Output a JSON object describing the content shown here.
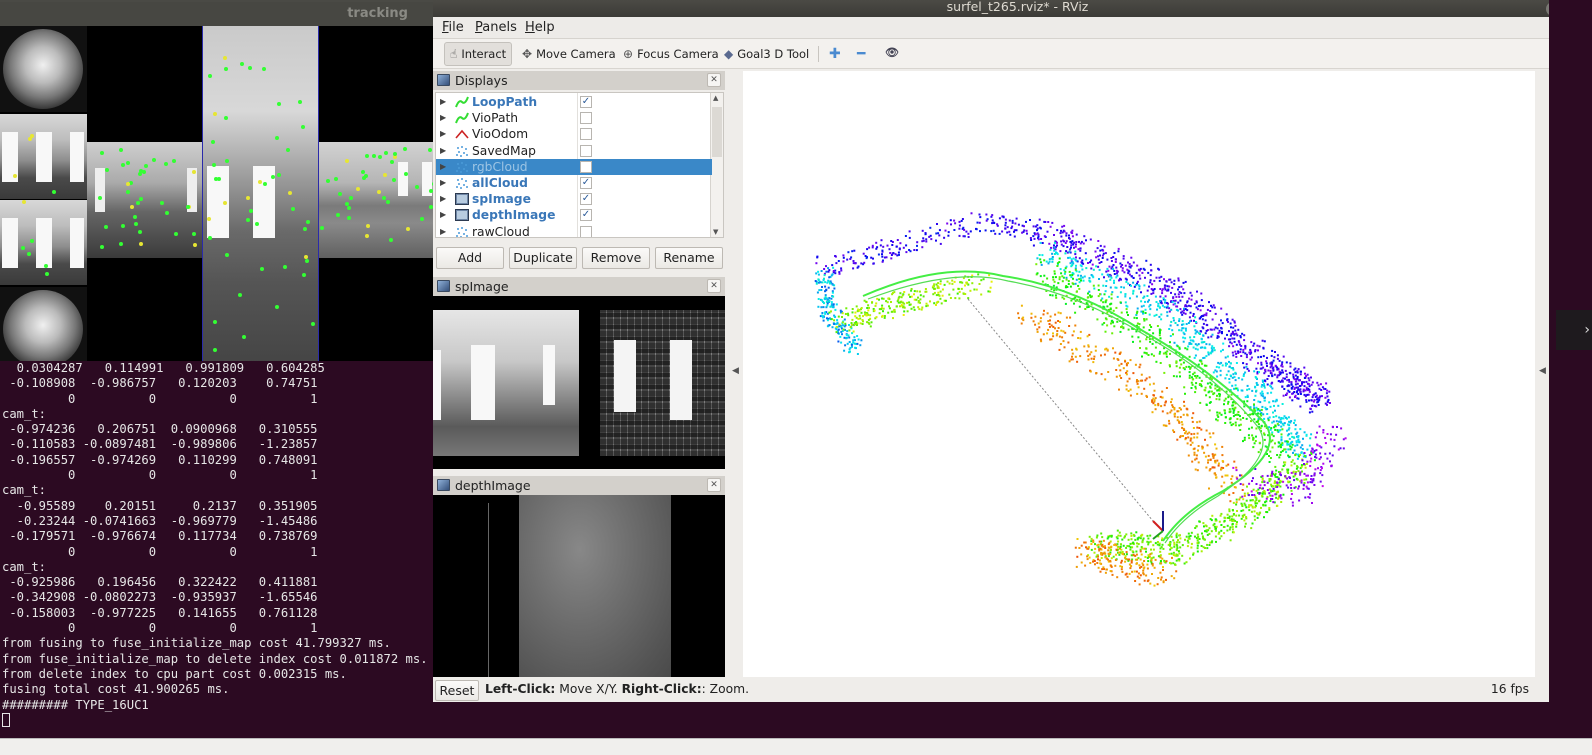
{
  "tracking_window": {
    "title": "tracking"
  },
  "terminal": {
    "lines": [
      "  0.0304287   0.114991   0.991809   0.604285",
      " -0.108908  -0.986757   0.120203    0.74751",
      "         0          0          0          1",
      "cam_t:",
      " -0.974236   0.206751  0.0900968   0.310555",
      " -0.110583 -0.0897481  -0.989806   -1.23857",
      " -0.196557  -0.974269   0.110299   0.748091",
      "         0          0          0          1",
      "cam_t:",
      "  -0.95589    0.20151     0.2137   0.351905",
      "  -0.23244 -0.0741663  -0.969779   -1.45486",
      " -0.179571  -0.976674   0.117734   0.738769",
      "         0          0          0          1",
      "cam_t:",
      " -0.925986   0.196456   0.322422   0.411881",
      " -0.342908 -0.0802273  -0.935937   -1.65546",
      " -0.158003  -0.977225   0.141655   0.761128",
      "         0          0          0          1",
      "from fusing to fuse_initialize_map cost 41.799327 ms.",
      "from fuse_initialize_map to delete index cost 0.011872 ms.",
      "from delete index to cpu part cost 0.002315 ms.",
      "fusing total cost 41.900265 ms.",
      "######### TYPE_16UC1"
    ]
  },
  "rviz": {
    "title": "surfel_t265.rviz* - RViz",
    "window_controls": {
      "minimize": "–",
      "maximize": "□",
      "close": "×"
    },
    "menu": [
      {
        "label": "File",
        "mnemonic": "F",
        "rest": "ile"
      },
      {
        "label": "Panels",
        "mnemonic": "P",
        "rest": "anels"
      },
      {
        "label": "Help",
        "mnemonic": "H",
        "rest": "elp"
      }
    ],
    "toolbar": {
      "interact": "Interact",
      "move_camera": "Move Camera",
      "focus_camera": "Focus Camera",
      "goal3d": "Goal3 D Tool",
      "icons": {
        "interact": "☝",
        "move_camera": "✥",
        "focus_camera": "⊕",
        "goal3d": "◆",
        "add": "✚",
        "remove": "━",
        "view": "👁"
      }
    },
    "displays_panel": {
      "title": "Displays",
      "items": [
        {
          "label": "LoopPath",
          "icon": "path",
          "checked": true,
          "bold": true,
          "selected": false
        },
        {
          "label": "VioPath",
          "icon": "path",
          "checked": false,
          "bold": false,
          "selected": false
        },
        {
          "label": "VioOdom",
          "icon": "odom",
          "checked": false,
          "bold": false,
          "selected": false
        },
        {
          "label": "SavedMap",
          "icon": "cloud",
          "checked": false,
          "bold": false,
          "selected": false
        },
        {
          "label": "rgbCloud",
          "icon": "cloud",
          "checked": false,
          "bold": false,
          "selected": true
        },
        {
          "label": "allCloud",
          "icon": "cloud",
          "checked": true,
          "bold": true,
          "selected": false
        },
        {
          "label": "spImage",
          "icon": "image",
          "checked": true,
          "bold": true,
          "selected": false
        },
        {
          "label": "depthImage",
          "icon": "image",
          "checked": true,
          "bold": true,
          "selected": false
        },
        {
          "label": "rawCloud",
          "icon": "cloud",
          "checked": false,
          "bold": false,
          "selected": false
        }
      ],
      "buttons": {
        "add": "Add",
        "duplicate": "Duplicate",
        "remove": "Remove",
        "rename": "Rename"
      }
    },
    "spimage_panel": {
      "title": "spImage"
    },
    "depthimage_panel": {
      "title": "depthImage"
    },
    "status": {
      "reset": "Reset",
      "left_click_label": "Left-Click:",
      "left_click_text": " Move X/Y. ",
      "right_click_label": "Right-Click:",
      "right_click_text": ": Zoom.",
      "fps": "16 fps"
    }
  },
  "colors": {
    "terminal_bg": "#2c0a22",
    "selection": "#3a88c8",
    "path_green": "#44ee44",
    "odom_red": "#cc2222"
  }
}
